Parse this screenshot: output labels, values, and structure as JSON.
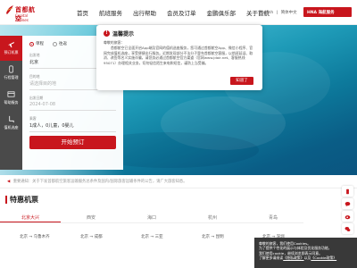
{
  "header": {
    "logo_cn": "首都航空",
    "logo_en": "Capital Airlines",
    "nav": [
      "首页",
      "航班服务",
      "出行帮助",
      "会员及订单",
      "金鹏俱乐部",
      "关于首航"
    ],
    "lang_en": "English",
    "lang_sep": "|",
    "lang_cn": "简体中文",
    "hna_label": "HNA 海航服务"
  },
  "sidebar": {
    "tabs": [
      {
        "label": "预订机票",
        "icon": "plane-icon",
        "active": true
      },
      {
        "label": "行程管理",
        "icon": "phone-icon",
        "active": false
      },
      {
        "label": "帮助服务",
        "icon": "help-icon",
        "active": false
      },
      {
        "label": "值机选座",
        "icon": "seat-icon",
        "active": false
      }
    ]
  },
  "booking": {
    "trip_oneway": "单程",
    "trip_round": "往返",
    "from_label": "出发地",
    "from_value": "北京",
    "to_label": "目的地",
    "to_value": "请选择目的地",
    "date_label": "出发日期",
    "date_value": "2024-07-08",
    "pax_label": "乘客",
    "pax_value": "1成人，0儿童，0婴儿",
    "search_button": "开始预订"
  },
  "modal": {
    "title": "温馨提示",
    "greeting": "尊敬的旅客：",
    "body": "首都航空已全面开启App端及官网的值机选座服务，您可通过首都航空App、微信小程序、官网完成值机选座，享受便捷出行服务。近期发现部分不法分子冒充首都航空客服，以航班延误、取消、改签等名义实施诈骗，请您务必通过首都航空官方渠道（官网www.jdair.net、客服热线95071）办理相关业务，切勿轻信陌生来电和短信，谨防上当受骗。",
    "confirm_button": "知道了"
  },
  "notice": {
    "text": "重要通知：关于下发首都航空旅客运输服务总条件及国内/国际旅客运输条件的公告，请广大旅客知悉。"
  },
  "special": {
    "title": "特惠机票",
    "cities": [
      "北京大兴",
      "西安",
      "海口",
      "杭州",
      "青岛"
    ],
    "active_city": 0,
    "routes": [
      "北京 → 乌鲁木齐",
      "北京 → 成都",
      "北京 → 三亚",
      "北京 → 昆明",
      "北京 → 深圳"
    ]
  },
  "tools": [
    "phone-icon",
    "chat-icon",
    "weibo-icon",
    "wechat-icon"
  ],
  "cookie": {
    "line1": "尊敬的旅客，我们使用Cookies。",
    "line2": "为了提供个性化的展示与体验及优化服务功能，",
    "line3": "我们使用cookie，继续浏览即表示同意。",
    "link_prefix": "了解更多请阅读",
    "link_text": "《隐私政策》",
    "link_suffix": "以及",
    "link_text2": "《Cookie政策》"
  },
  "colors": {
    "brand": "#c8161d",
    "sidebar_bg": "#4a4a4a",
    "sea_dark": "#0b5580",
    "sea_light": "#6fd1df"
  }
}
